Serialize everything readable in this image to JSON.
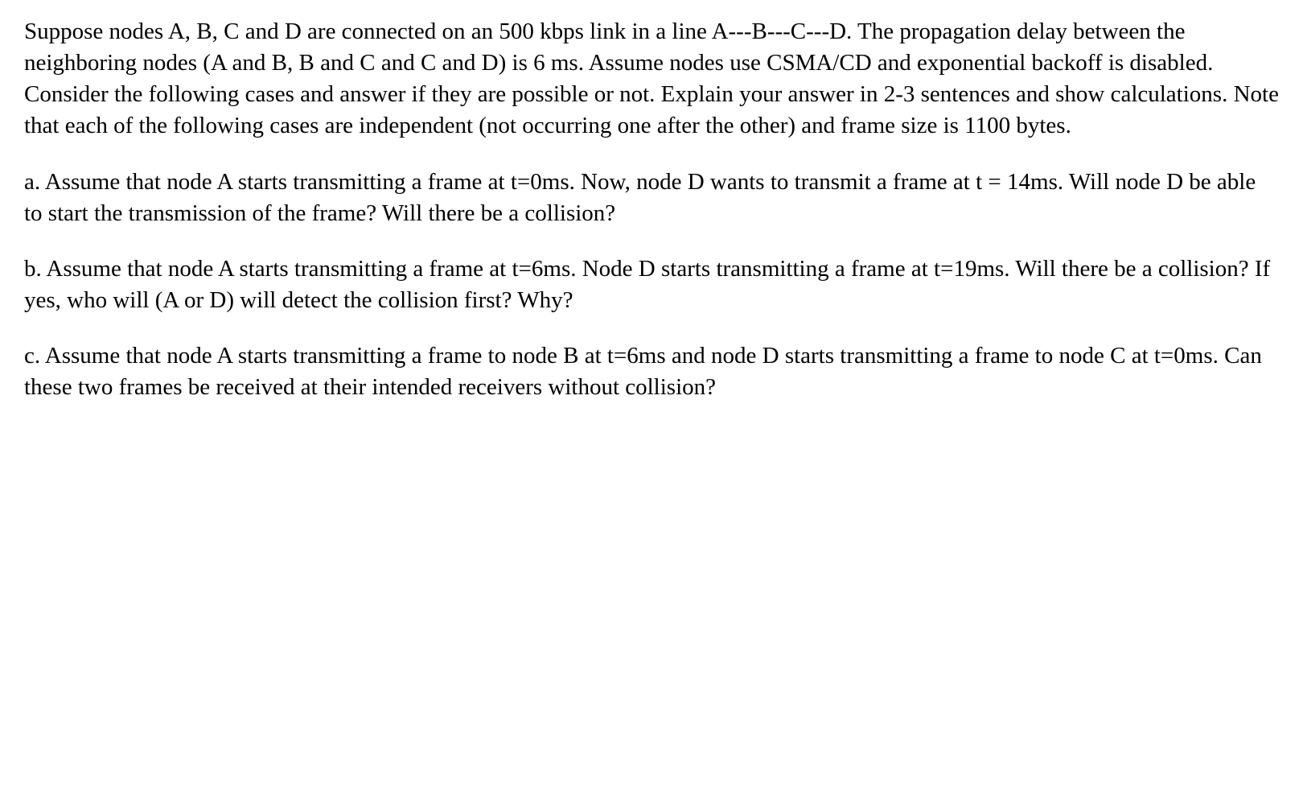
{
  "intro": "Suppose nodes A, B, C and D are connected on an 500 kbps link in a line A---B---C---D. The propagation delay between the neighboring nodes (A and B, B and C and C and D) is 6 ms. Assume nodes use CSMA/CD and exponential backoff is disabled. Consider the following cases and answer if they are possible or not. Explain your answer in 2-3 sentences and show calculations. Note that each of the following cases are independent (not occurring one after the other) and frame size is 1100 bytes.",
  "questions": {
    "a": " a. Assume that node A starts transmitting a frame at t=0ms. Now, node D wants to transmit a frame at t = 14ms. Will node D be able to start the transmission of the frame? Will there be a collision?",
    "b": "b. Assume that node A starts transmitting a frame at t=6ms. Node D starts transmitting a frame at t=19ms. Will there be a collision? If yes, who will (A or D) will detect the collision first? Why?",
    "c": "c. Assume that node A starts transmitting a frame to node B at t=6ms and node D starts transmitting a frame to node C at t=0ms. Can these two frames be received at their intended receivers without collision?"
  }
}
